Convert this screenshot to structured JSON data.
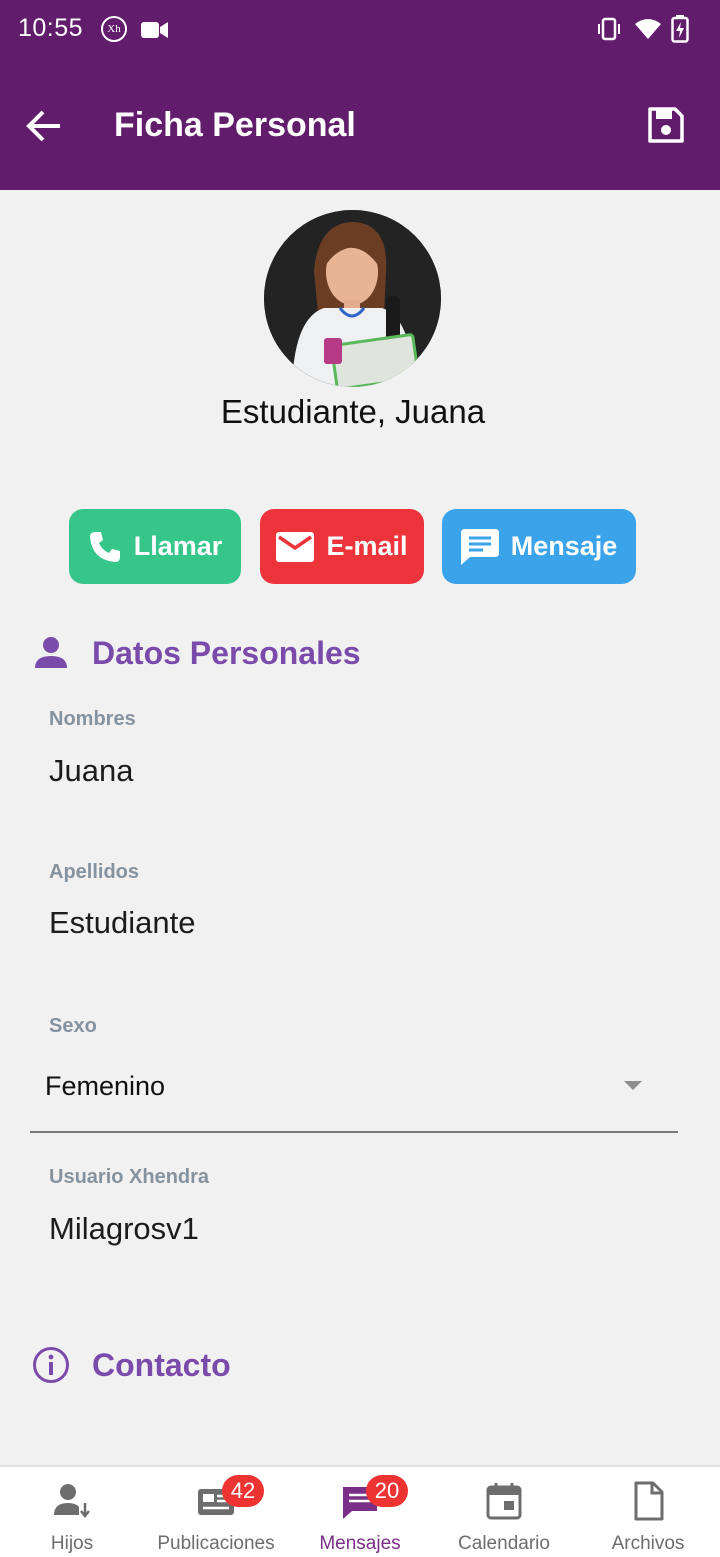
{
  "status_bar": {
    "time": "10:55",
    "app_badge": "Xh"
  },
  "app_bar": {
    "title": "Ficha Personal"
  },
  "profile": {
    "name": "Estudiante, Juana"
  },
  "actions": {
    "call": "Llamar",
    "email": "E-mail",
    "message": "Mensaje"
  },
  "personal_section": {
    "title": "Datos Personales",
    "fields": [
      {
        "label": "Nombres",
        "value": "Juana"
      },
      {
        "label": "Apellidos",
        "value": "Estudiante"
      },
      {
        "label": "Sexo",
        "value": "Femenino"
      },
      {
        "label": "Usuario Xhendra",
        "value": "Milagrosv1"
      }
    ]
  },
  "contact_section": {
    "title": "Contacto"
  },
  "bottom_nav": {
    "items": [
      {
        "label": "Hijos",
        "icon": "child-user-icon"
      },
      {
        "label": "Publicaciones",
        "icon": "newspaper-icon",
        "badge": "42"
      },
      {
        "label": "Mensajes",
        "icon": "chat-icon",
        "badge": "20"
      },
      {
        "label": "Calendario",
        "icon": "calendar-icon"
      },
      {
        "label": "Archivos",
        "icon": "file-icon"
      }
    ],
    "active": "Mensajes"
  },
  "colors": {
    "app_bar": "#611c6b",
    "accent": "#7b4bab",
    "call": "#37c68a",
    "email": "#ec343a",
    "message": "#3ba3ea",
    "badge": "#ee3333"
  }
}
